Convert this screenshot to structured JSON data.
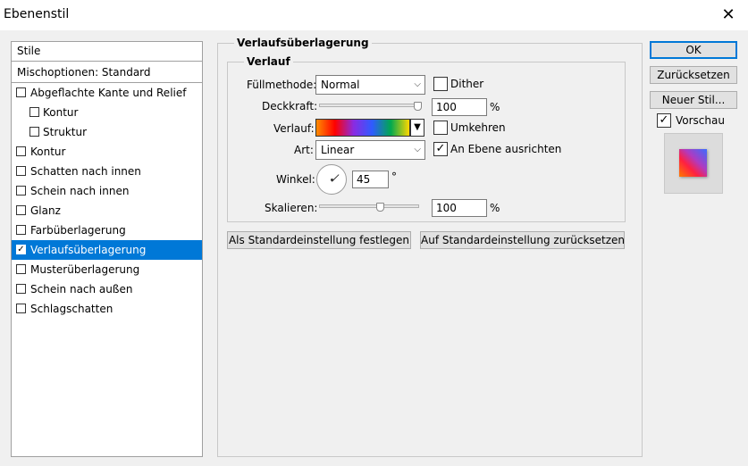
{
  "window": {
    "title": "Ebenenstil",
    "close_glyph": "✕"
  },
  "styles_panel": {
    "header": "Stile",
    "blend_options": "Mischoptionen: Standard",
    "items": [
      {
        "label": "Abgeflachte Kante und Relief",
        "checked": false,
        "sub": false
      },
      {
        "label": "Kontur",
        "checked": false,
        "sub": true
      },
      {
        "label": "Struktur",
        "checked": false,
        "sub": true
      },
      {
        "label": "Kontur",
        "checked": false,
        "sub": false
      },
      {
        "label": "Schatten nach innen",
        "checked": false,
        "sub": false
      },
      {
        "label": "Schein nach innen",
        "checked": false,
        "sub": false
      },
      {
        "label": "Glanz",
        "checked": false,
        "sub": false
      },
      {
        "label": "Farbüberlagerung",
        "checked": false,
        "sub": false
      },
      {
        "label": "Verlaufsüberlagerung",
        "checked": true,
        "sub": false,
        "selected": true
      },
      {
        "label": "Musterüberlagerung",
        "checked": false,
        "sub": false
      },
      {
        "label": "Schein nach außen",
        "checked": false,
        "sub": false
      },
      {
        "label": "Schlagschatten",
        "checked": false,
        "sub": false
      }
    ]
  },
  "overlay": {
    "group_title": "Verlaufsüberlagerung",
    "sub_title": "Verlauf",
    "blend_mode_label": "Füllmethode:",
    "blend_mode_value": "Normal",
    "dither_label": "Dither",
    "dither_checked": false,
    "opacity_label": "Deckkraft:",
    "opacity_value": "100",
    "percent": "%",
    "gradient_label": "Verlauf:",
    "reverse_label": "Umkehren",
    "reverse_checked": false,
    "style_label": "Art:",
    "style_value": "Linear",
    "align_label": "An Ebene ausrichten",
    "align_checked": true,
    "angle_label": "Winkel:",
    "angle_value": "45",
    "degree": "°",
    "scale_label": "Skalieren:",
    "scale_value": "100",
    "make_default_button": "Als Standardeinstellung festlegen",
    "reset_default_button": "Auf Standardeinstellung zurücksetzen"
  },
  "right_panel": {
    "ok_button": "OK",
    "reset_button": "Zurücksetzen",
    "new_style_button": "Neuer Stil...",
    "preview_label": "Vorschau",
    "preview_checked": true
  },
  "colors": {
    "selection": "#0078d7",
    "accent": "#0078d7"
  },
  "icons": {
    "checkmark": "✓",
    "dropdown_arrow": "⌵",
    "gradient_arrow": "▼"
  }
}
